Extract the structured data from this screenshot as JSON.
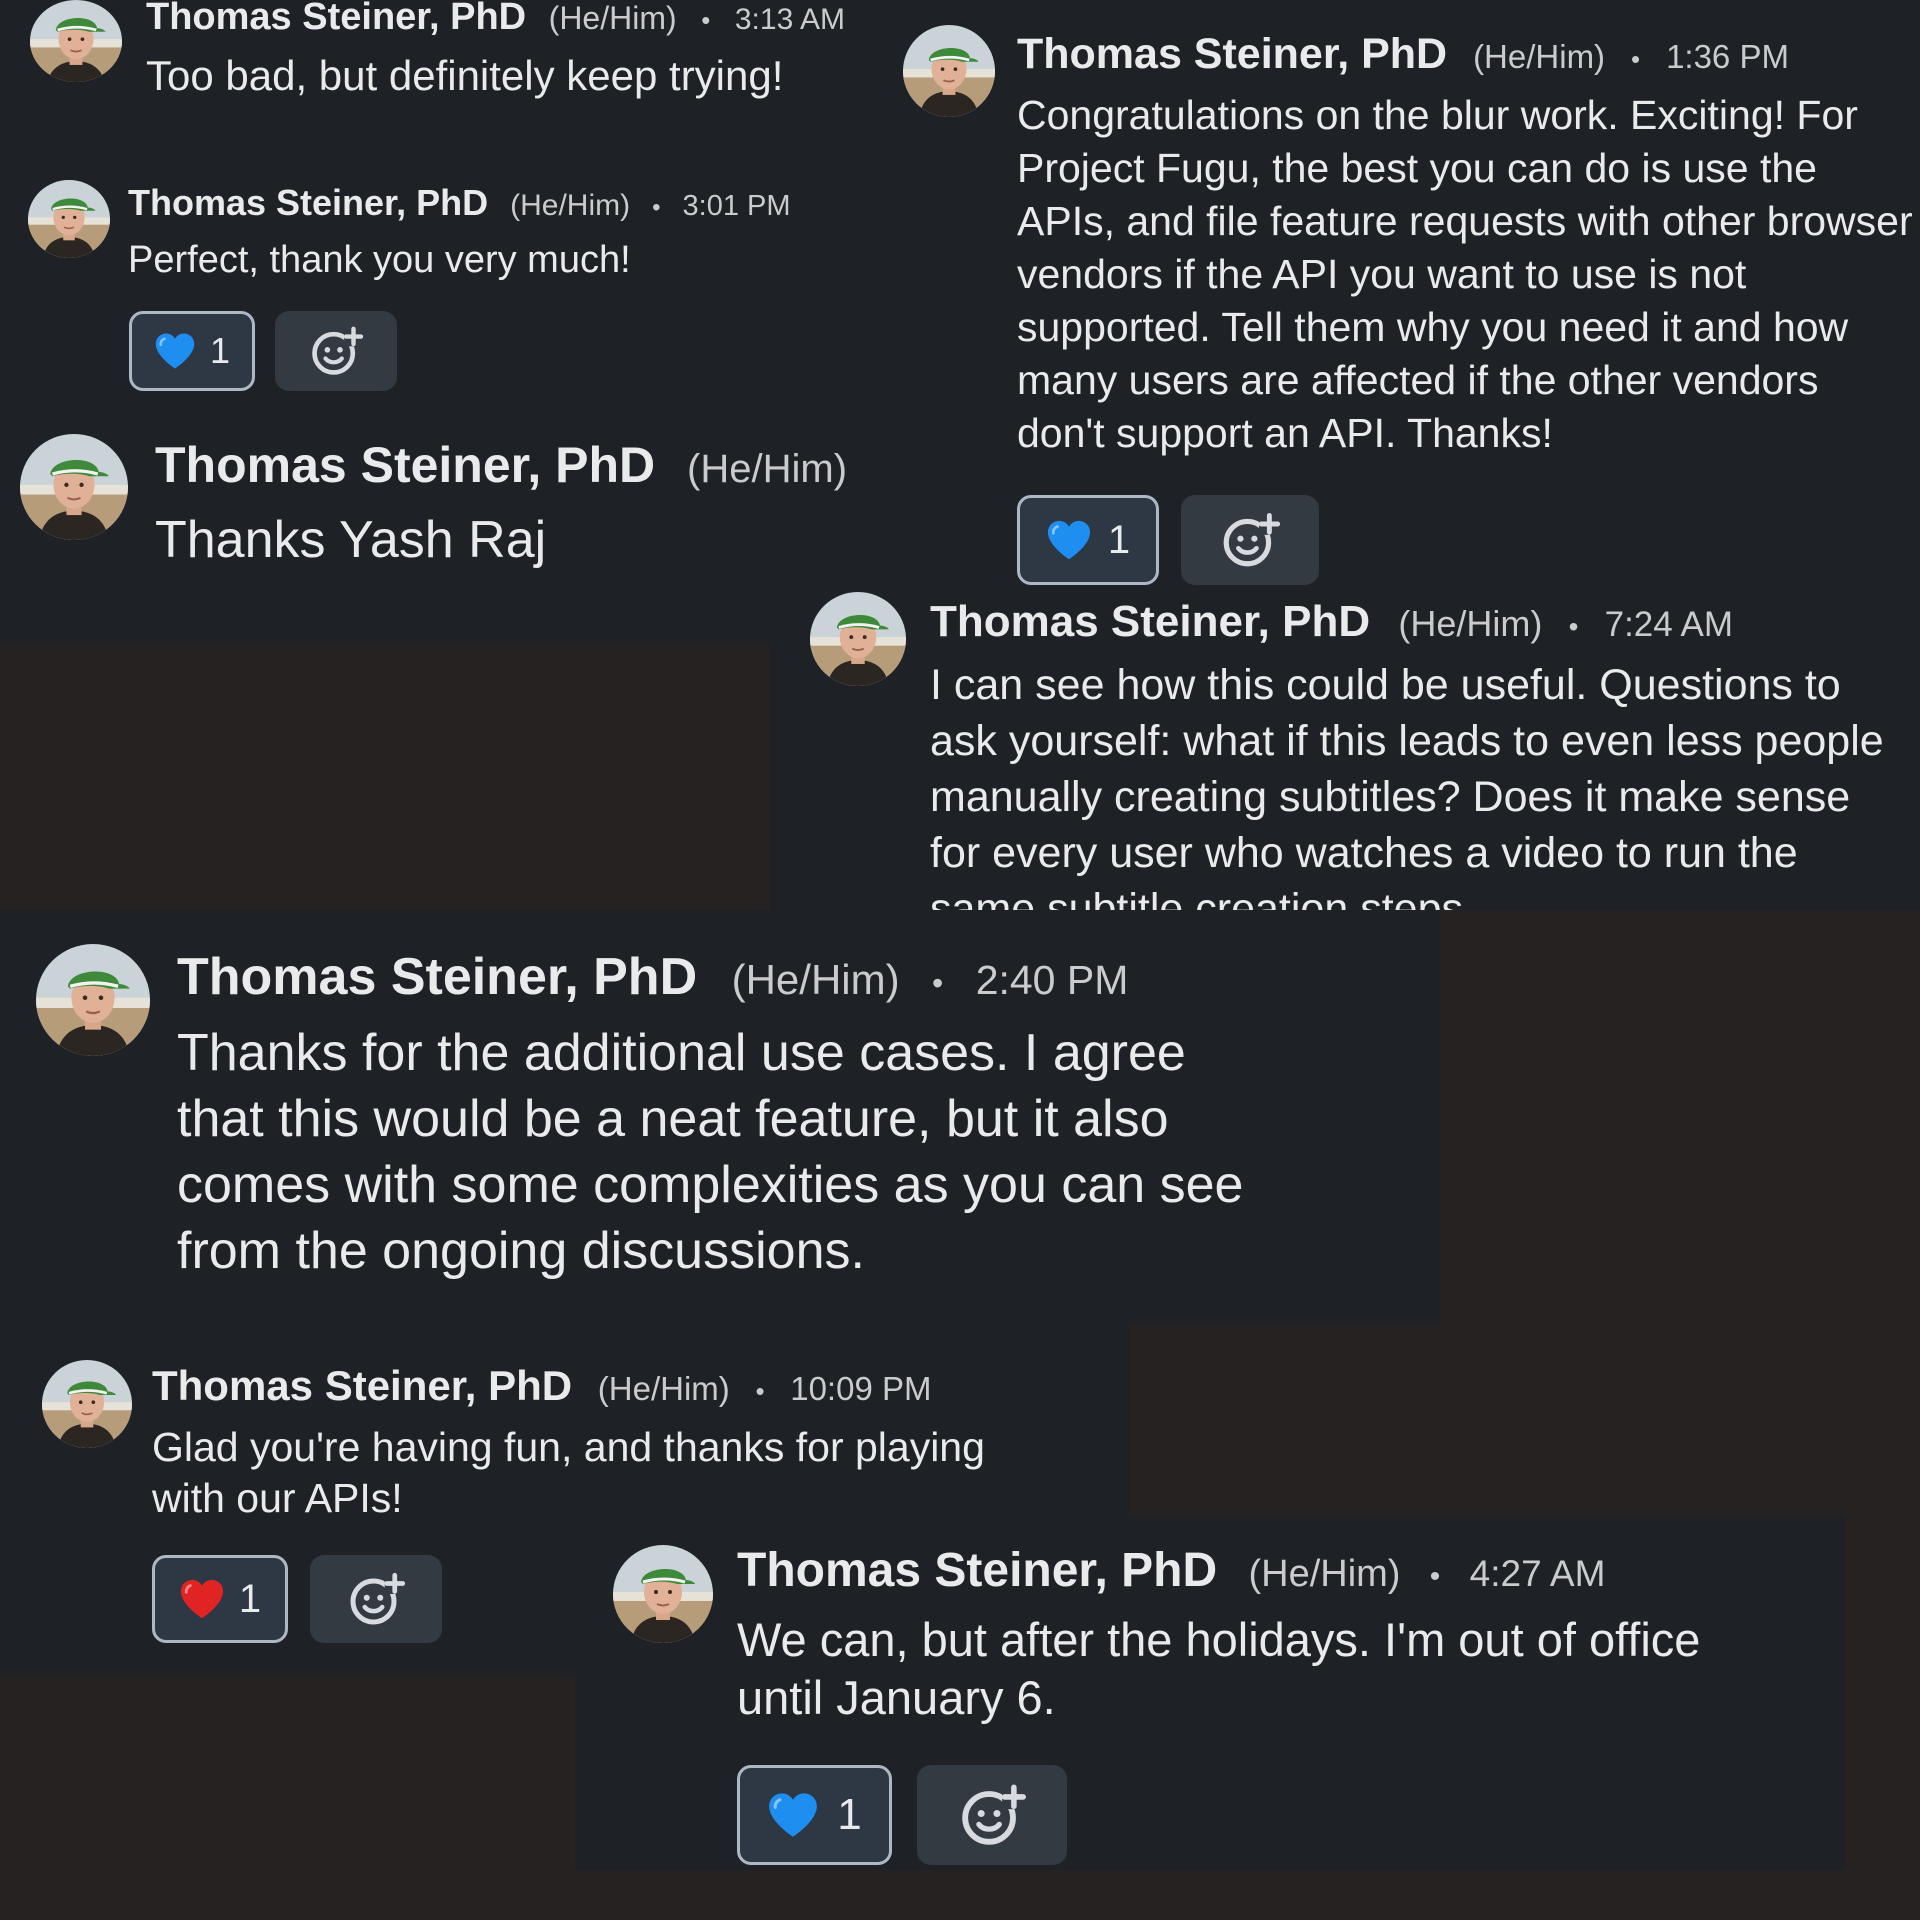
{
  "messages": [
    {
      "author": "Thomas Steiner, PhD",
      "pronouns": "(He/Him)",
      "separator": "•",
      "time": "3:13 AM",
      "text": "Too bad, but definitely keep trying!"
    },
    {
      "author": "Thomas Steiner, PhD",
      "pronouns": "(He/Him)",
      "separator": "•",
      "time": "3:01 PM",
      "text": "Perfect, thank you very much!",
      "reaction": {
        "emoji": "blue-heart-icon",
        "count": "1"
      }
    },
    {
      "author": "Thomas Steiner, PhD",
      "pronouns": "(He/Him)",
      "text": "Thanks Yash Raj"
    },
    {
      "author": "Thomas Steiner, PhD",
      "pronouns": "(He/Him)",
      "separator": "•",
      "time": "1:36 PM",
      "text": "Congratulations on the blur work. Exciting! For Project Fugu, the best you can do is use the APIs, and file feature requests with other browser vendors if the API you want to use is not supported. Tell them why you need it and how many users are affected if the other vendors don't support an API. Thanks!",
      "reaction": {
        "emoji": "blue-heart-icon",
        "count": "1"
      }
    },
    {
      "author": "Thomas Steiner, PhD",
      "pronouns": "(He/Him)",
      "separator": "•",
      "time": "7:24 AM",
      "text": "I can see how this could be useful. Questions to ask yourself: what if this leads to even less people manually creating subtitles? Does it make sense for every user who watches a video to run the same subtitle creation steps"
    },
    {
      "author": "Thomas Steiner, PhD",
      "pronouns": "(He/Him)",
      "separator": "•",
      "time": "2:40 PM",
      "text": "Thanks for the additional use cases. I agree that this would be a neat feature, but it also comes with some complexities as you can see from the ongoing discussions."
    },
    {
      "author": "Thomas Steiner, PhD",
      "pronouns": "(He/Him)",
      "separator": "•",
      "time": "10:09 PM",
      "text": "Glad you're having fun, and thanks for playing with our APIs!",
      "reaction": {
        "emoji": "red-heart-icon",
        "count": "1"
      }
    },
    {
      "author": "Thomas Steiner, PhD",
      "pronouns": "(He/Him)",
      "separator": "•",
      "time": "4:27 AM",
      "text": "We can, but after the holidays. I'm out of office until January 6.",
      "reaction": {
        "emoji": "blue-heart-icon",
        "count": "1"
      }
    }
  ],
  "colors": {
    "background": "#252221",
    "card": "#1e2227",
    "text": "#e9eaec",
    "muted": "#c9cbce",
    "pill_border": "#aeb7c4",
    "pill_fill": "#2e3744",
    "blue_heart": "#1f8ef1",
    "red_heart": "#e02424"
  },
  "icons": {
    "add_reaction": "add-reaction-icon",
    "avatar": "avatar"
  }
}
